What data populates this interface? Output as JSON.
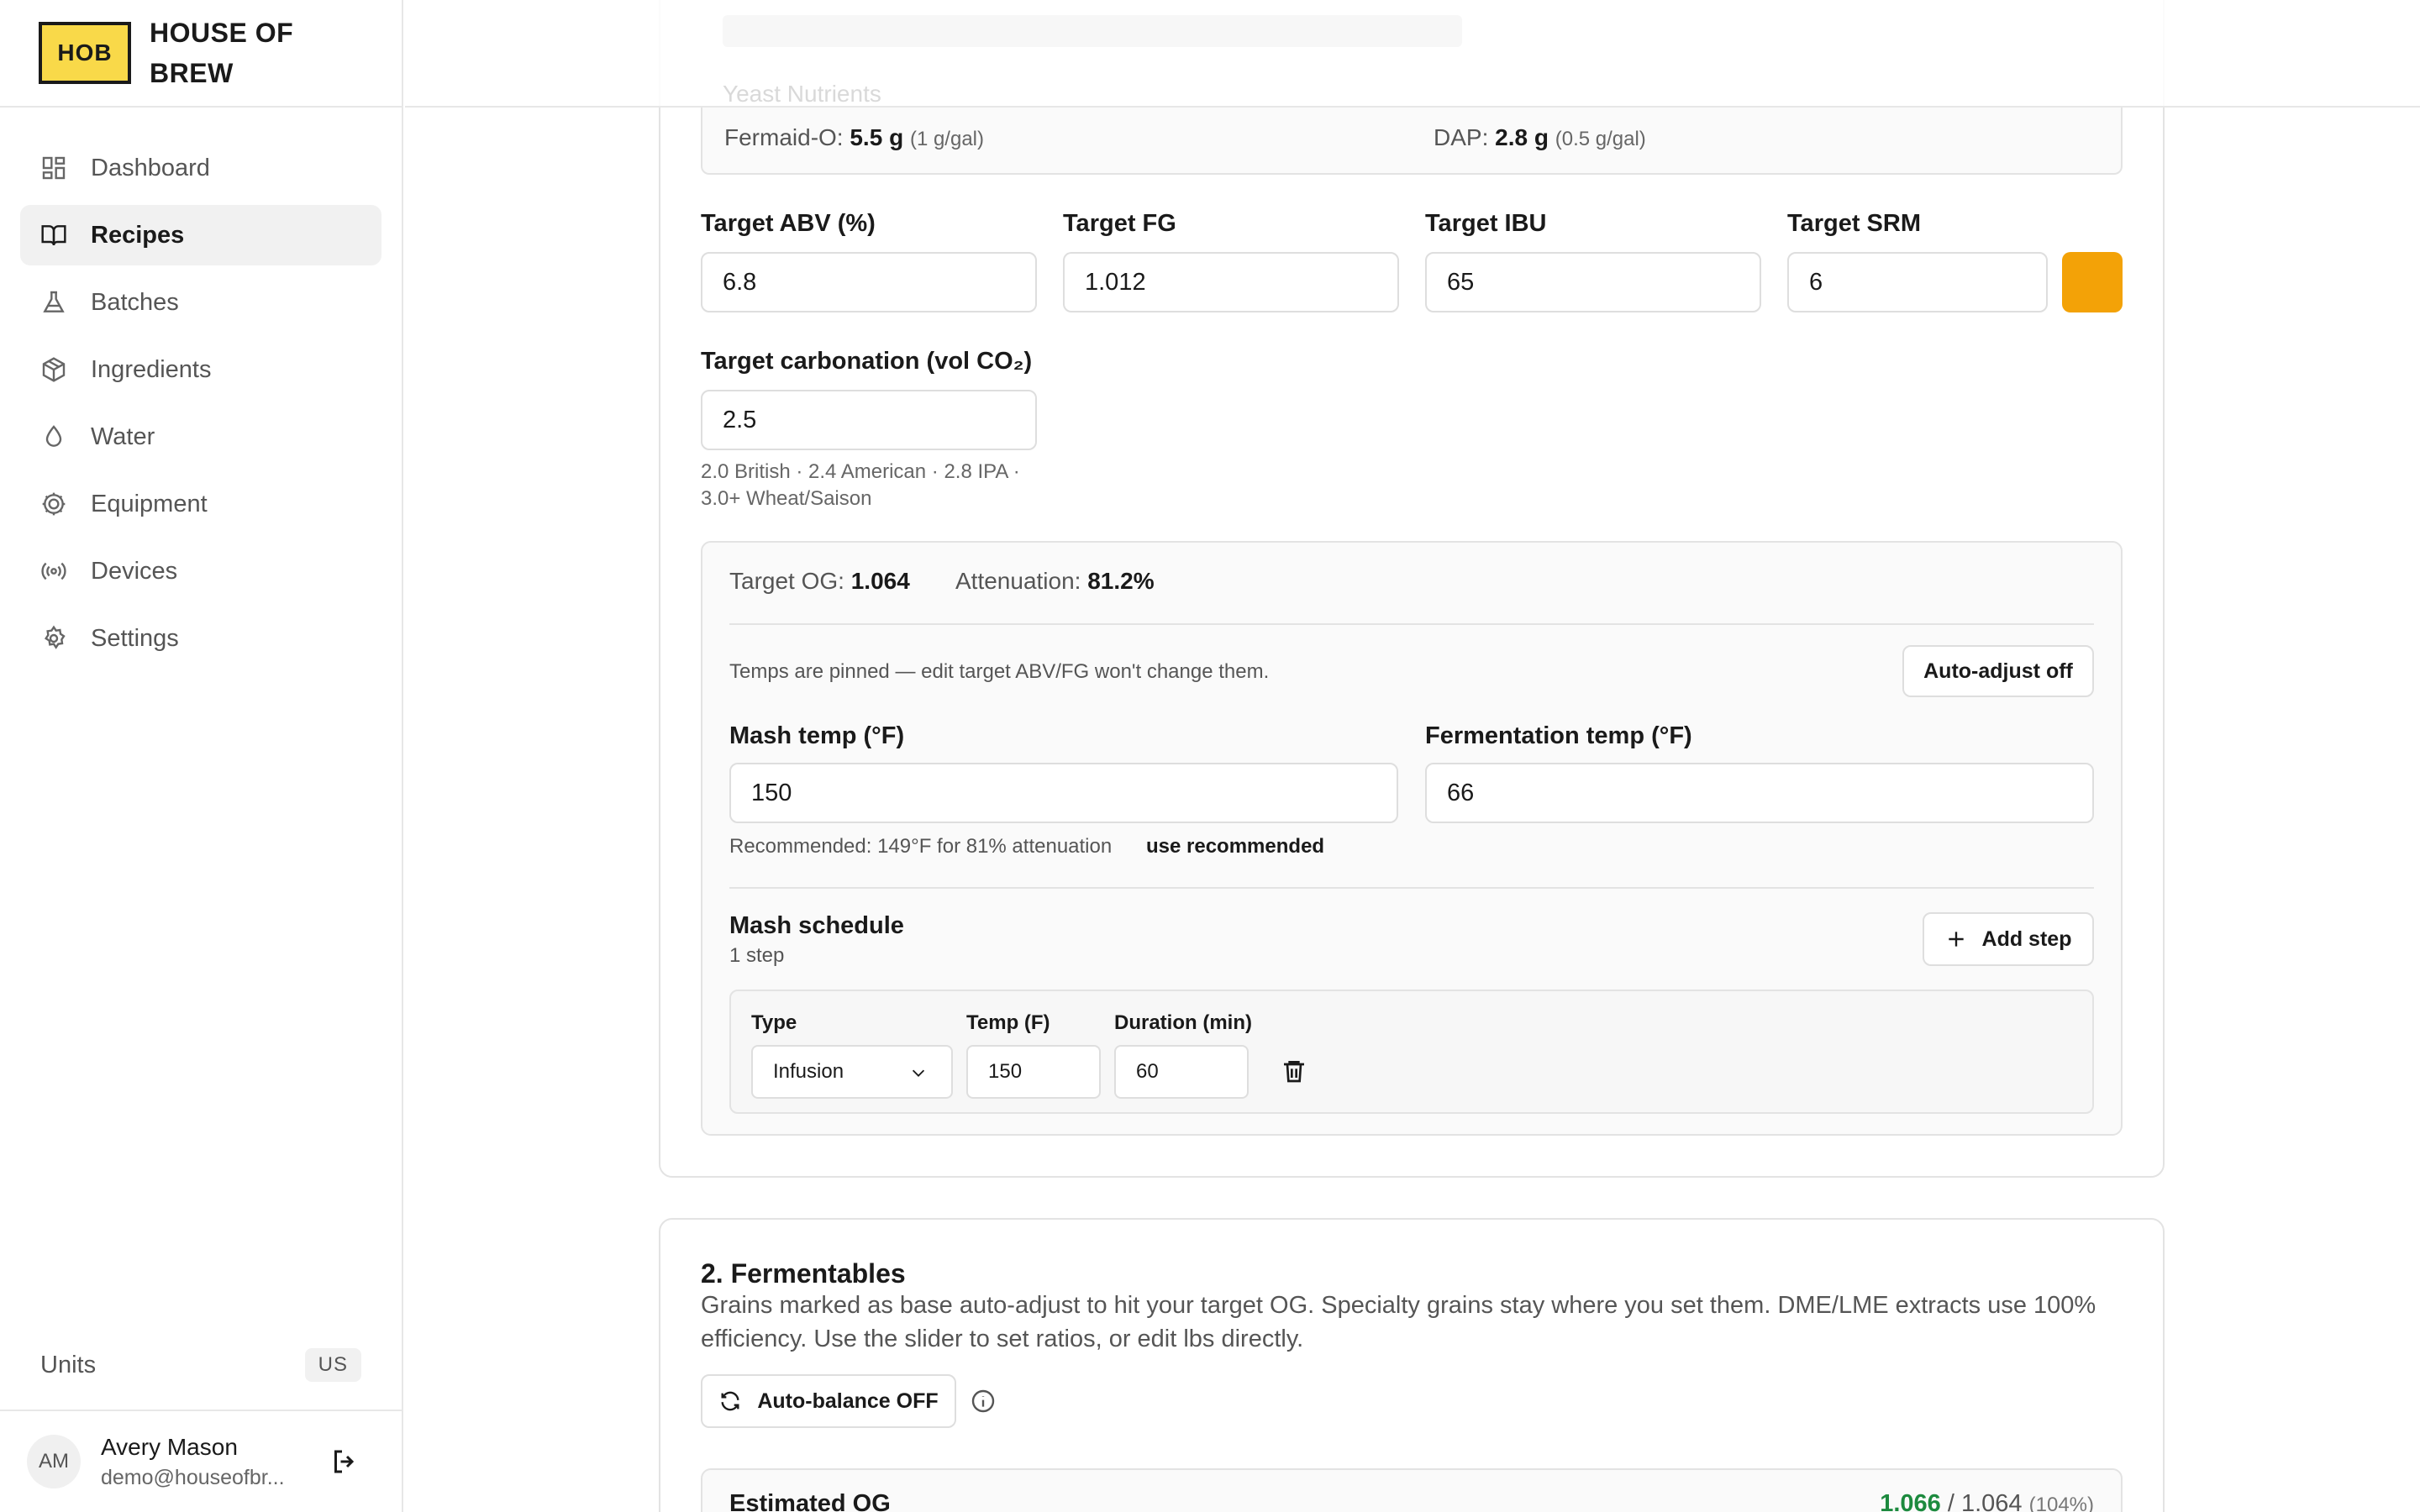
{
  "brand": {
    "logo": "HOB",
    "name": "HOUSE OF BREW"
  },
  "nav": [
    {
      "label": "Dashboard",
      "icon": "dashboard-icon"
    },
    {
      "label": "Recipes",
      "icon": "book-icon",
      "active": true
    },
    {
      "label": "Batches",
      "icon": "flask-icon"
    },
    {
      "label": "Ingredients",
      "icon": "package-icon"
    },
    {
      "label": "Water",
      "icon": "droplet-icon"
    },
    {
      "label": "Equipment",
      "icon": "cog-icon"
    },
    {
      "label": "Devices",
      "icon": "radio-icon"
    },
    {
      "label": "Settings",
      "icon": "gear-icon"
    }
  ],
  "units": {
    "label": "Units",
    "value": "US"
  },
  "user": {
    "initials": "AM",
    "name": "Avery Mason",
    "email": "demo@houseofbr..."
  },
  "yeast": {
    "section_label": "Yeast Nutrients",
    "fermaid_label": "Fermaid-O:",
    "fermaid_value": "5.5 g",
    "fermaid_rate": "(1 g/gal)",
    "dap_label": "DAP:",
    "dap_value": "2.8 g",
    "dap_rate": "(0.5 g/gal)"
  },
  "targets": {
    "abv_label": "Target ABV (%)",
    "abv": "6.8",
    "fg_label": "Target FG",
    "fg": "1.012",
    "ibu_label": "Target IBU",
    "ibu": "65",
    "srm_label": "Target SRM",
    "srm": "6",
    "srm_color": "#f3a207",
    "carb_label": "Target carbonation (vol CO₂)",
    "carb": "2.5",
    "carb_hint": "2.0 British · 2.4 American · 2.8 IPA · 3.0+ Wheat/Saison"
  },
  "panel": {
    "og_label": "Target OG:",
    "og": "1.064",
    "atten_label": "Attenuation:",
    "atten": "81.2%",
    "pinned_text": "Temps are pinned — edit target ABV/FG won't change them.",
    "auto_adjust": "Auto-adjust off",
    "mash_label": "Mash temp (°F)",
    "mash": "150",
    "ferm_label": "Fermentation temp (°F)",
    "ferm": "66",
    "recommended": "Recommended: 149°F for 81% attenuation",
    "use_recommended": "use recommended",
    "schedule_title": "Mash schedule",
    "schedule_count": "1 step",
    "add_step": "Add step",
    "col_type": "Type",
    "col_temp": "Temp (F)",
    "col_duration": "Duration (min)",
    "step": {
      "type": "Infusion",
      "temp": "150",
      "duration": "60"
    }
  },
  "fermentables": {
    "title": "2. Fermentables",
    "description": "Grains marked as base auto-adjust to hit your target OG. Specialty grains stay where you set them. DME/LME extracts use 100% efficiency. Use the slider to set ratios, or edit lbs directly.",
    "auto_balance": "Auto-balance OFF",
    "est_og_label": "Estimated OG",
    "est_og": "1.066",
    "target_og": "/ 1.064",
    "est_pct": "(104%)"
  }
}
